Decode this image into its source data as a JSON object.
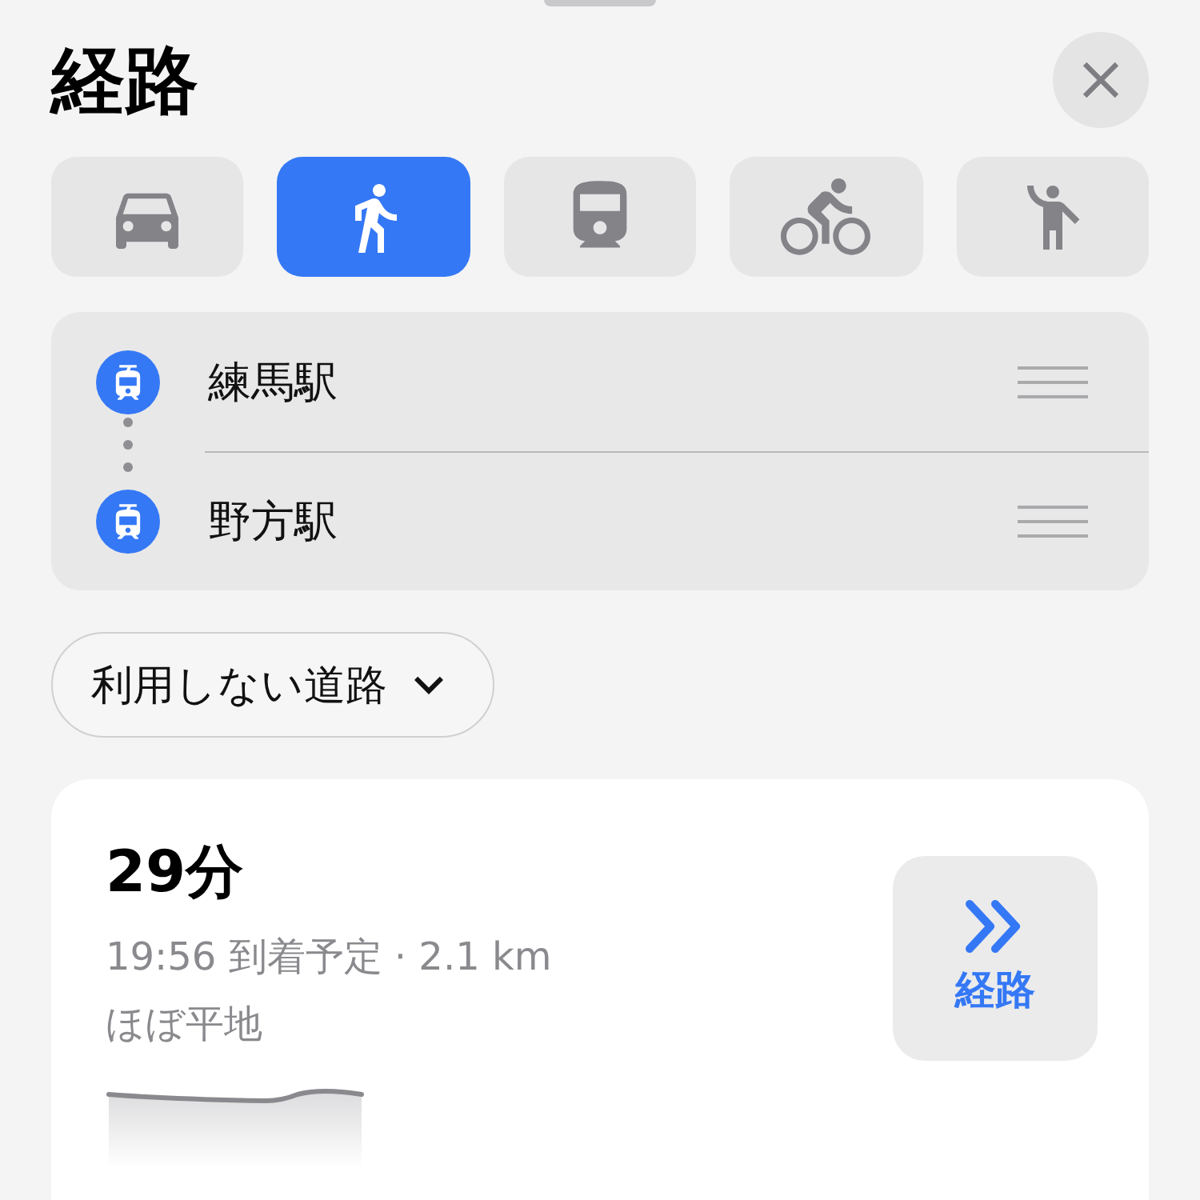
{
  "title": "経路",
  "modes": [
    {
      "kind": "car",
      "selected": false
    },
    {
      "kind": "walk",
      "selected": true
    },
    {
      "kind": "transit",
      "selected": false
    },
    {
      "kind": "bike",
      "selected": false
    },
    {
      "kind": "ride",
      "selected": false
    }
  ],
  "stops": [
    {
      "name": "練馬駅"
    },
    {
      "name": "野方駅"
    }
  ],
  "avoid_button": {
    "label": "利用しない道路"
  },
  "route": {
    "duration": "29分",
    "details": "19:56 到着予定 · 2.1 km",
    "terrain": "ほぼ平地",
    "go_button": {
      "label": "経路"
    }
  }
}
